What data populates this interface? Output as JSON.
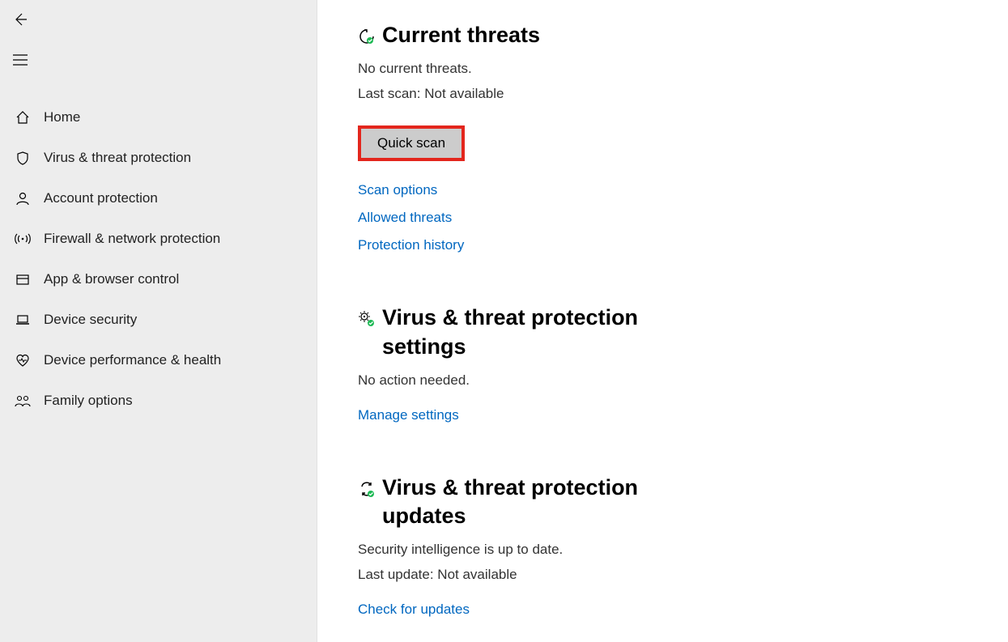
{
  "sidebar": {
    "items": [
      {
        "label": "Home"
      },
      {
        "label": "Virus & threat protection"
      },
      {
        "label": "Account protection"
      },
      {
        "label": "Firewall & network protection"
      },
      {
        "label": "App & browser control"
      },
      {
        "label": "Device security"
      },
      {
        "label": "Device performance & health"
      },
      {
        "label": "Family options"
      }
    ]
  },
  "main": {
    "threats": {
      "title": "Current threats",
      "status": "No current threats.",
      "last_scan": "Last scan: Not available",
      "quick_scan": "Quick scan",
      "links": {
        "scan_options": "Scan options",
        "allowed_threats": "Allowed threats",
        "protection_history": "Protection history"
      }
    },
    "settings": {
      "title": "Virus & threat protection settings",
      "status": "No action needed.",
      "link": "Manage settings"
    },
    "updates": {
      "title": "Virus & threat protection updates",
      "status": "Security intelligence is up to date.",
      "last_update": "Last update: Not available",
      "link": "Check for updates"
    }
  }
}
